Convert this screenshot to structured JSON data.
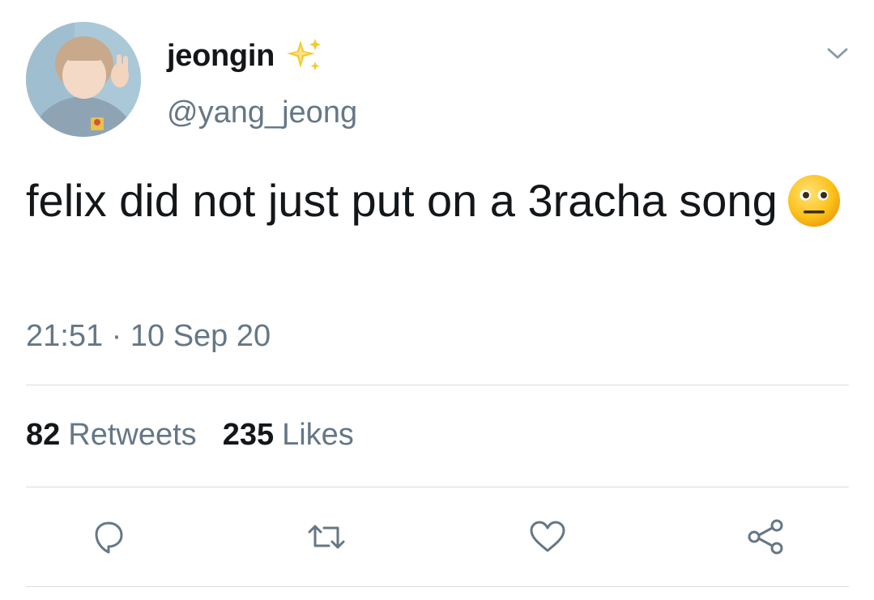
{
  "author": {
    "display_name": "jeongin",
    "handle": "@yang_jeong",
    "badge_icon": "sparkles-icon",
    "avatar_icon": "profile-photo"
  },
  "tweet": {
    "text": "felix did not just put on a 3racha song",
    "emoji_icon": "neutral-face-emoji",
    "timestamp": "21:51 · 10 Sep 20"
  },
  "stats": {
    "retweets_count": "82",
    "retweets_label": "Retweets",
    "likes_count": "235",
    "likes_label": "Likes"
  },
  "actions": [
    "reply-icon",
    "retweet-icon",
    "like-icon",
    "share-icon"
  ],
  "colors": {
    "text_primary": "#14171a",
    "text_secondary": "#657786",
    "divider": "#d6dde2",
    "icon": "#657786"
  }
}
